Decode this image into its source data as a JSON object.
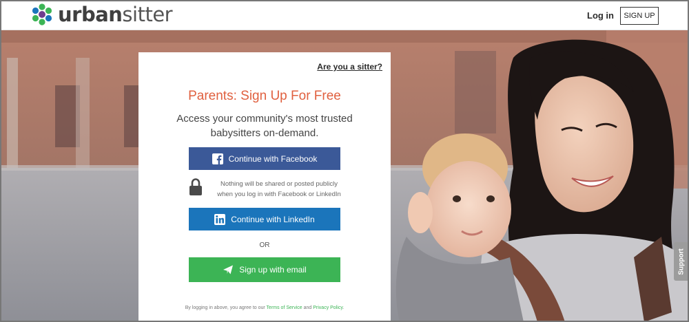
{
  "brand": {
    "name_bold": "urban",
    "name_light": "sitter",
    "logo_colors": [
      "#3cb455",
      "#1b75bb",
      "#6f3c8e"
    ]
  },
  "header": {
    "login_label": "Log in",
    "signup_label": "SIGN UP"
  },
  "card": {
    "sitter_link": "Are you a sitter?",
    "title": "Parents: Sign Up For Free",
    "subtitle": "Access your community's most trusted babysitters on-demand.",
    "facebook_label": "Continue with Facebook",
    "privacy_line1": "Nothing will be shared or posted publicly",
    "privacy_line2": "when you log in with Facebook or LinkedIn",
    "linkedin_label": "Continue with LinkedIn",
    "or_label": "OR",
    "email_label": "Sign up with email",
    "terms_prefix": "By logging in above, you agree to our ",
    "terms_link": "Terms of Service",
    "terms_and": " and ",
    "privacy_link": "Privacy Policy",
    "terms_suffix": "."
  },
  "support": {
    "label": "Support"
  },
  "colors": {
    "accent_title": "#e0603f",
    "facebook": "#3b5998",
    "linkedin": "#1b75bb",
    "email": "#3cb455"
  }
}
